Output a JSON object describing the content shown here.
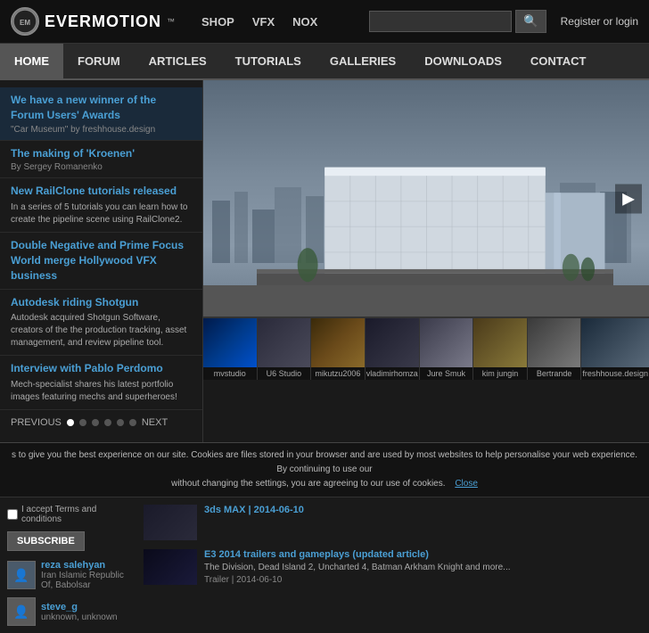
{
  "header": {
    "logo_text": "EVERMOTION",
    "logo_tm": "™",
    "top_nav": [
      {
        "label": "SHOP",
        "href": "#"
      },
      {
        "label": "VFX",
        "href": "#"
      },
      {
        "label": "NOX",
        "href": "#"
      }
    ],
    "search_placeholder": "",
    "register_label": "Register or login"
  },
  "main_nav": [
    {
      "label": "HOME",
      "active": true
    },
    {
      "label": "FORUM"
    },
    {
      "label": "ARTICLES"
    },
    {
      "label": "TUTORIALS"
    },
    {
      "label": "GALLERIES"
    },
    {
      "label": "DOWNLOADS"
    },
    {
      "label": "CONTACT"
    }
  ],
  "sidebar": {
    "items": [
      {
        "title": "We have a new winner of the Forum Users' Awards",
        "subtitle": "\"Car Museum\" by freshhouse.design",
        "highlight": true
      },
      {
        "title": "The making of 'Kroenen'",
        "subtitle": "By Sergey Romanenko"
      },
      {
        "title": "New RailClone tutorials released",
        "text": "In a series of 5 tutorials you can learn how to create the pipeline scene using RailClone2."
      },
      {
        "title": "Double Negative and Prime Focus World merge Hollywood VFX business"
      },
      {
        "title": "Autodesk riding Shotgun",
        "text": "Autodesk acquired Shotgun Software, creators of the the production tracking, asset management, and review pipeline tool."
      },
      {
        "title": "Interview with Pablo Perdomo",
        "text": "Mech-specialist shares his latest portfolio images featuring mechs and superheroes!"
      }
    ],
    "prev_label": "PREVIOUS",
    "next_label": "NEXT"
  },
  "thumbnails": [
    {
      "label": "mvstudio",
      "type": "blue"
    },
    {
      "label": "U6 Studio",
      "type": "room"
    },
    {
      "label": "mikutzu2006",
      "type": "gold"
    },
    {
      "label": "vladimirhomza",
      "type": "dark"
    },
    {
      "label": "Jure Smuk",
      "type": "arch"
    },
    {
      "label": "kim jungin",
      "type": "desert"
    },
    {
      "label": "Bertrande",
      "type": "cathedral"
    },
    {
      "label": "freshhouse.design",
      "type": "building2"
    }
  ],
  "cookie": {
    "text": "s to give you the best experience on our site. Cookies are files stored in your browser and are used by most websites to help personalise your web experience. By continuing to use our",
    "text2": "without changing the settings, you are agreeing to our use of cookies.",
    "close_label": "Close"
  },
  "bottom": {
    "users": [
      {
        "name": "reza salehyan",
        "location": "Iran Islamic Republic Of, Babolsar"
      },
      {
        "name": "steve_g",
        "location": "unknown, unknown"
      }
    ],
    "subscribe": {
      "checkbox_label": "I accept Terms and conditions",
      "button_label": "SUBSCRIBE"
    },
    "news": [
      {
        "title": "3ds MAX  |  2014-06-10",
        "type": "dark"
      },
      {
        "title": "E3 2014 trailers and gameplays (updated article)",
        "desc": "The Division, Dead Island 2, Uncharted 4, Batman Arkham Knight and more...",
        "meta": "Trailer  |  2014-06-10",
        "type": "game"
      }
    ]
  }
}
